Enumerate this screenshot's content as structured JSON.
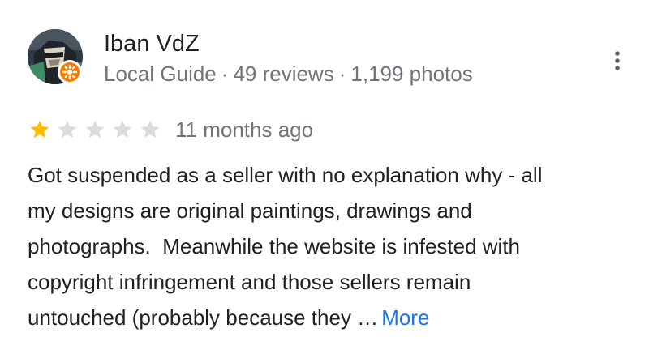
{
  "review": {
    "author": {
      "name": "Iban VdZ",
      "badge": "Local Guide",
      "reviews": "49 reviews",
      "photos": "1,199 photos",
      "separator": "·"
    },
    "rating": {
      "value": 1,
      "max": 5,
      "filled_color": "#fbbc04",
      "empty_color": "#dadce0"
    },
    "time": "11 months ago",
    "text_lines": [
      "Got suspended as a seller with no explanation why - all",
      "my designs are original paintings, drawings and",
      "photographs.  Meanwhile the website is infested with",
      "copyright infringement and those sellers remain",
      "untouched (probably because they …"
    ],
    "more_label": "More",
    "colors": {
      "link": "#1a73e8",
      "secondary_text": "#70757a",
      "badge": "#f57c00"
    },
    "icons": {
      "more_options": "more-vert-icon",
      "guide_badge": "local-guide-badge-icon",
      "star": "star-icon"
    }
  }
}
